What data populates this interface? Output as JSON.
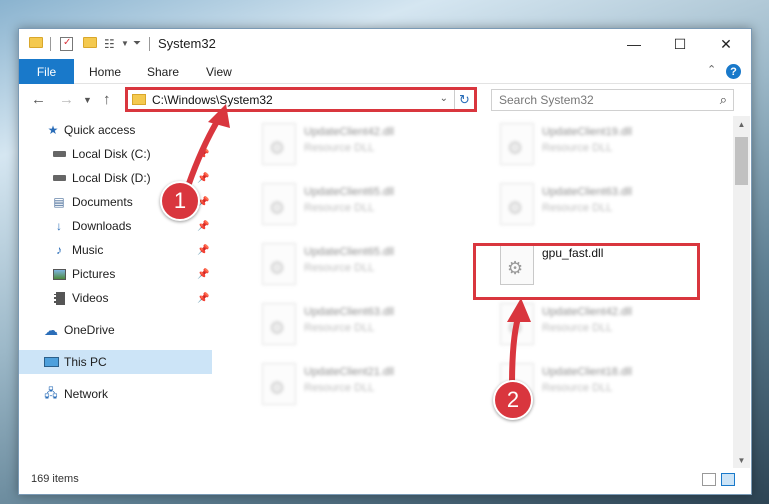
{
  "window": {
    "title": "System32",
    "minimize_icon": "minimize-icon",
    "maximize_icon": "maximize-icon",
    "close_icon": "close-icon"
  },
  "ribbon": {
    "file_tab": "File",
    "tabs": [
      "Home",
      "Share",
      "View"
    ]
  },
  "navigation": {
    "address_path": "C:\\Windows\\System32",
    "search_placeholder": "Search System32"
  },
  "sidebar": {
    "items": [
      {
        "label": "Quick access",
        "icon": "star-icon"
      },
      {
        "label": "Local Disk (C:)",
        "icon": "drive-icon"
      },
      {
        "label": "Local Disk (D:)",
        "icon": "drive-icon"
      },
      {
        "label": "Documents",
        "icon": "documents-icon"
      },
      {
        "label": "Downloads",
        "icon": "download-icon"
      },
      {
        "label": "Music",
        "icon": "music-icon"
      },
      {
        "label": "Pictures",
        "icon": "pictures-icon"
      },
      {
        "label": "Videos",
        "icon": "videos-icon"
      },
      {
        "label": "OneDrive",
        "icon": "cloud-icon"
      },
      {
        "label": "This PC",
        "icon": "computer-icon"
      },
      {
        "label": "Network",
        "icon": "network-icon"
      }
    ]
  },
  "files": [
    {
      "name": "UpdateClient42.dll",
      "type": "Resource DLL"
    },
    {
      "name": "UpdateClient19.dll",
      "type": "Resource DLL"
    },
    {
      "name": "UpdateClient65.dll",
      "type": "Resource DLL"
    },
    {
      "name": "UpdateClient63.dll",
      "type": "Resource DLL"
    },
    {
      "name": "UpdateClient65.dll",
      "type": "Resource DLL"
    },
    {
      "name": "gpu_fast.dll",
      "type": ""
    },
    {
      "name": "UpdateClient63.dll",
      "type": "Resource DLL"
    },
    {
      "name": "UpdateClient42.dll",
      "type": "Resource DLL"
    },
    {
      "name": "UpdateClient21.dll",
      "type": "Resource DLL"
    },
    {
      "name": "UpdateClient18.dll",
      "type": "Resource DLL"
    }
  ],
  "status": {
    "item_count": "169 items"
  },
  "callouts": [
    "1",
    "2"
  ],
  "colors": {
    "accent": "#1979ca",
    "highlight": "#d9363e",
    "selected": "#cce4f7"
  }
}
